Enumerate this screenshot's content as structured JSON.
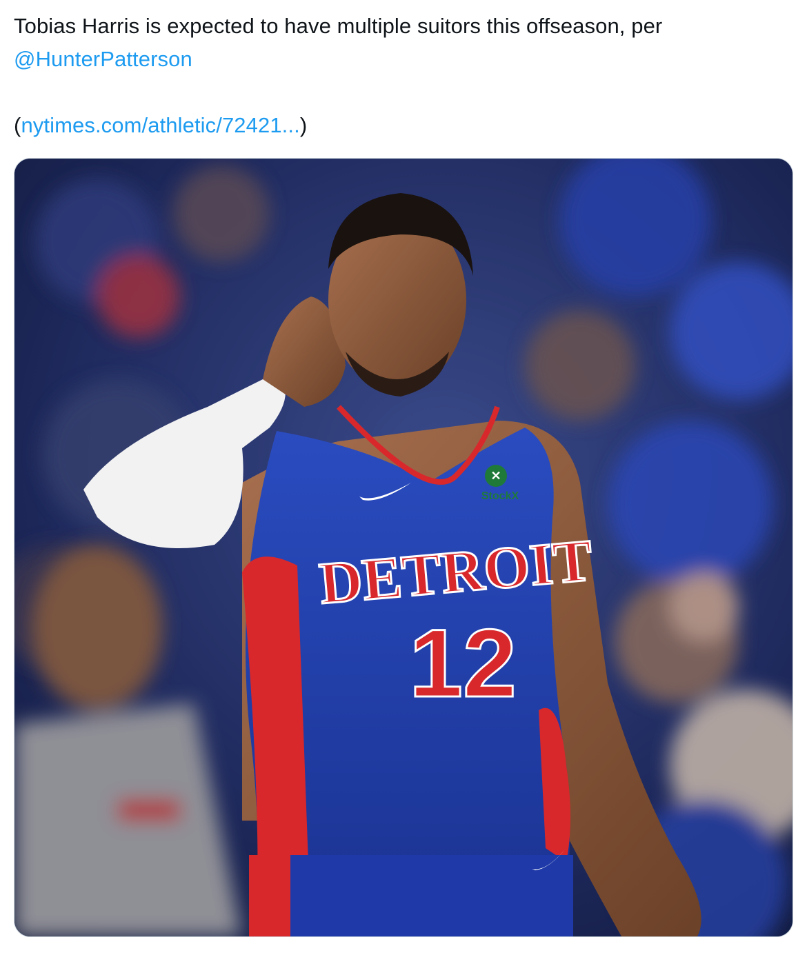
{
  "tweet": {
    "text_line1": "Tobias Harris is expected to have multiple suitors this offseason, per",
    "mention": "@HunterPatterson",
    "link_open_paren": "(",
    "link_text": "nytimes.com/athletic/72421...",
    "link_close_paren": ")"
  },
  "media": {
    "photo": {
      "jersey_team": "DETROIT",
      "jersey_number": "12",
      "sponsor_patch": "StockX"
    }
  },
  "colors": {
    "link": "#1d9bf0",
    "text": "#0f1419",
    "jersey_blue": "#1f3fa8",
    "jersey_red": "#d8282c"
  }
}
